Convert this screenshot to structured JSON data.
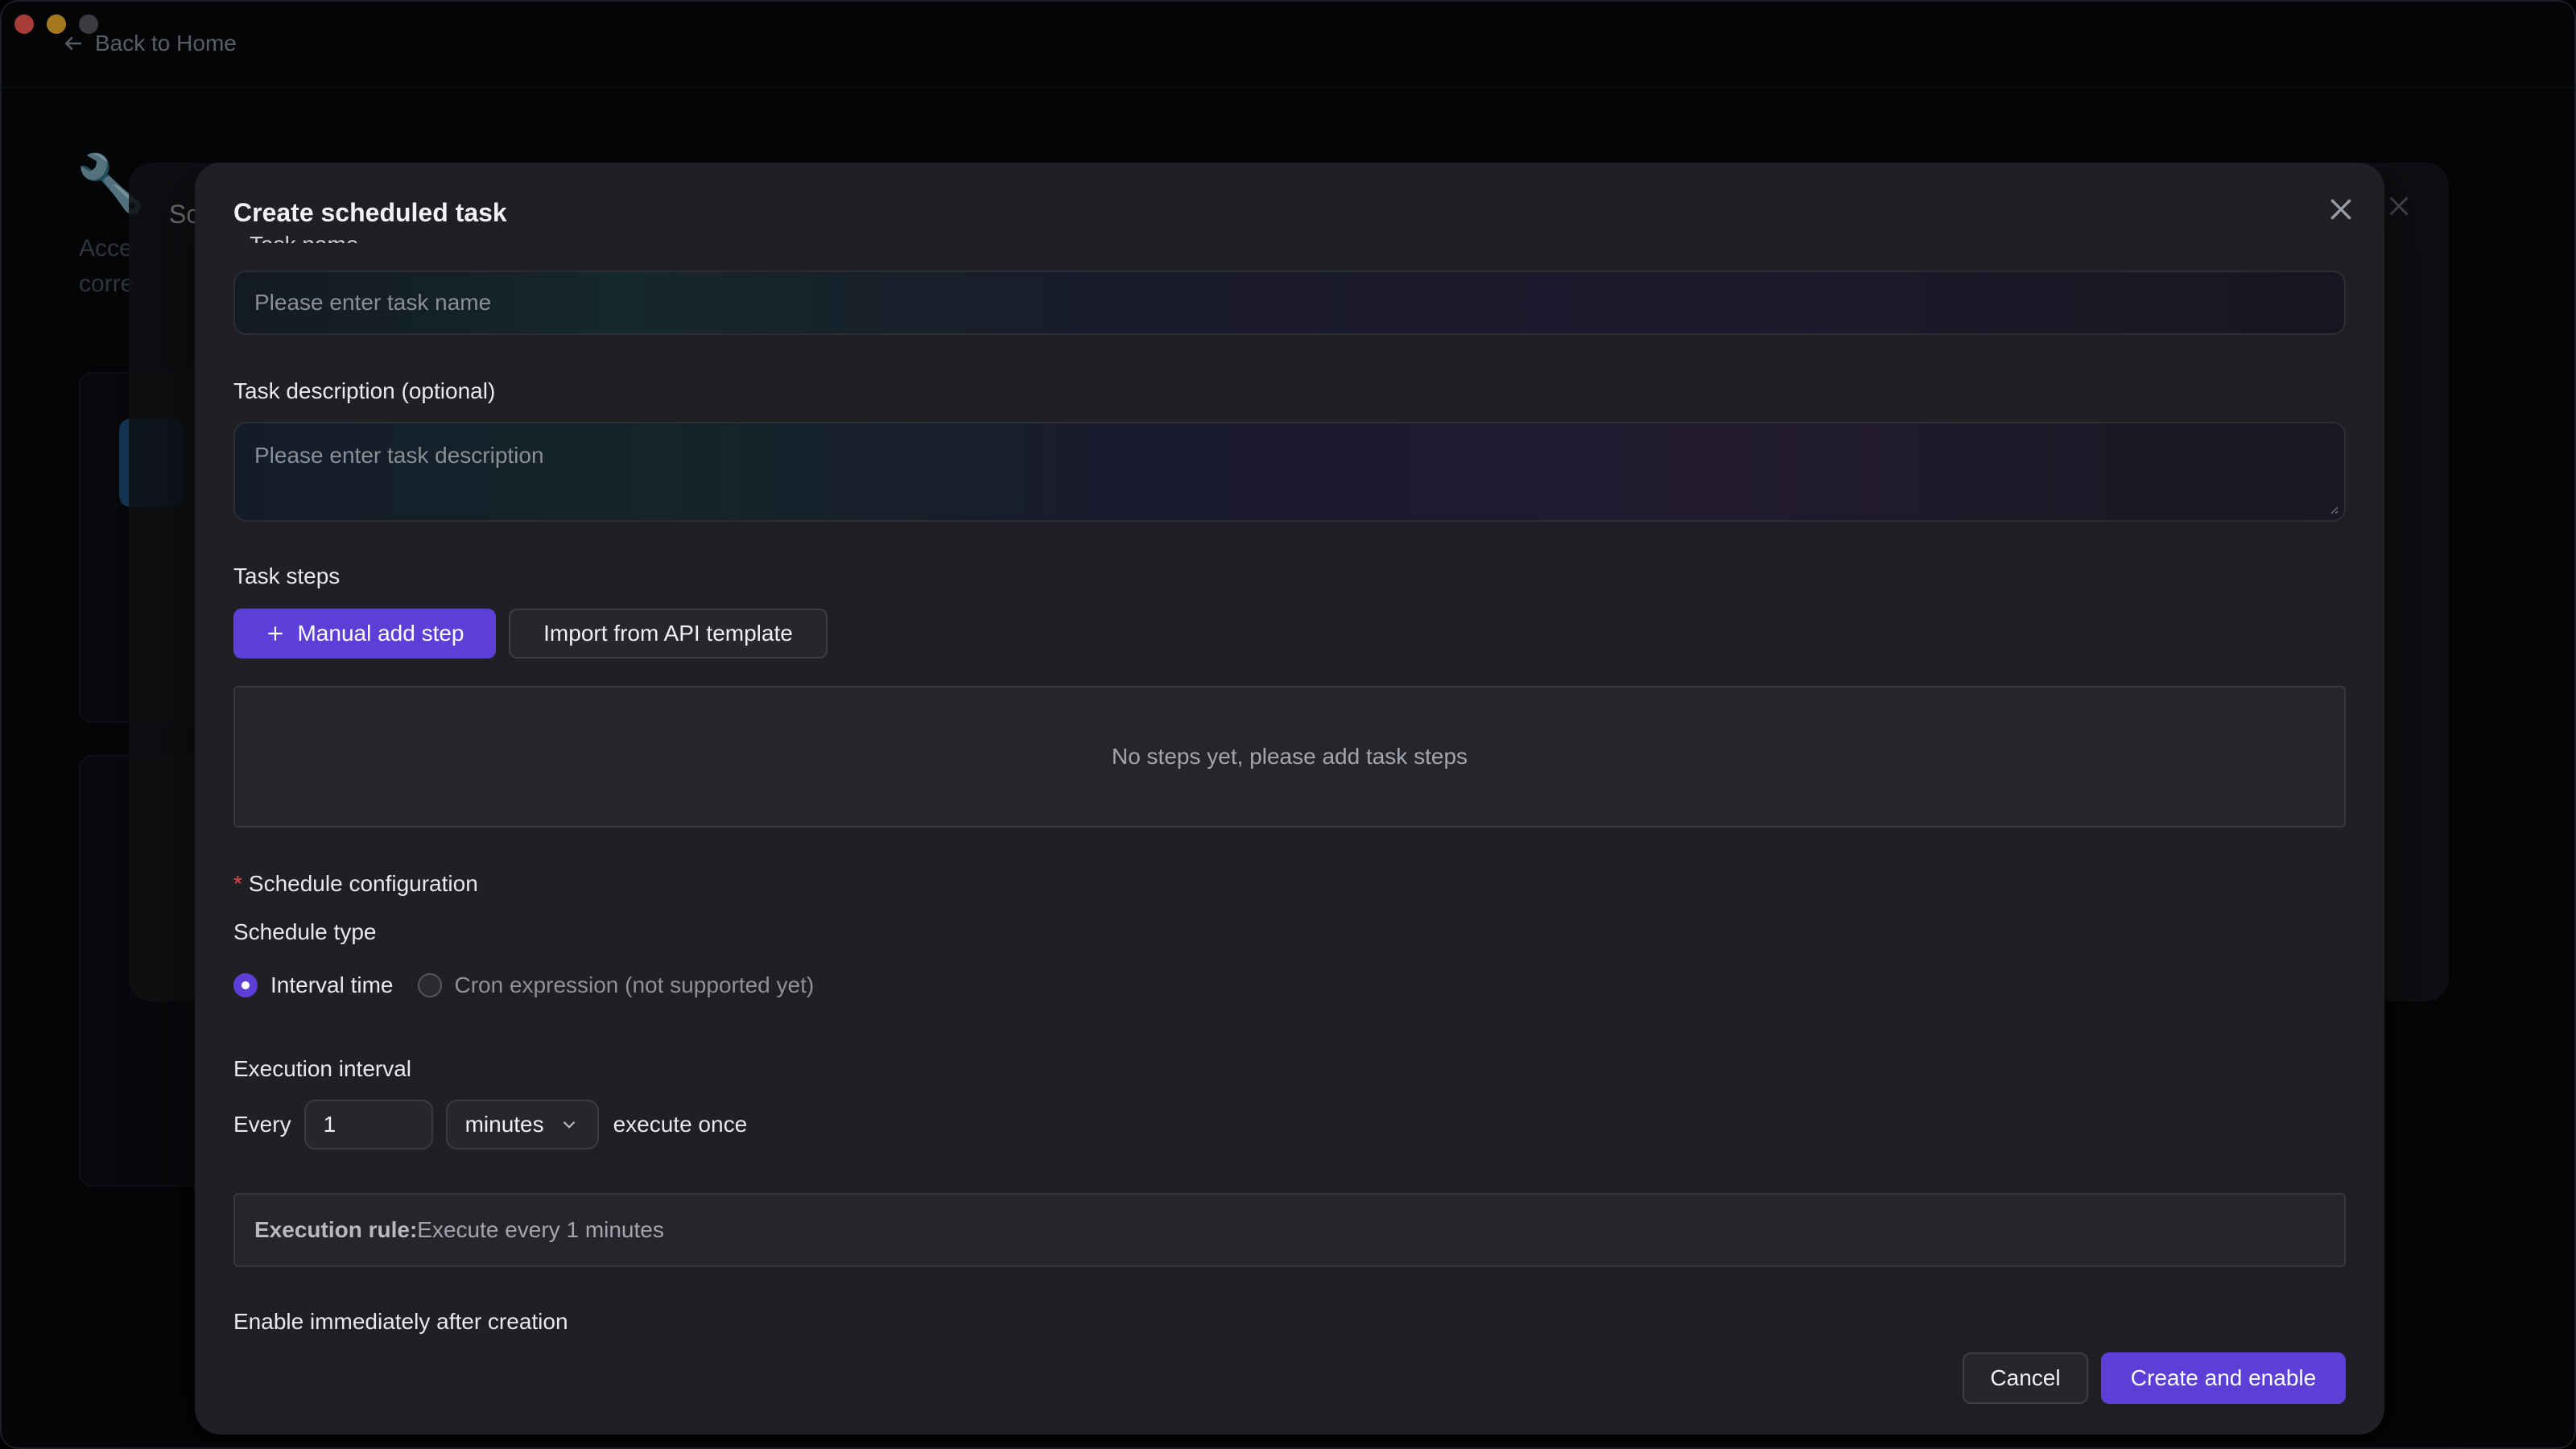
{
  "window": {
    "back_label": "Back to Home"
  },
  "background": {
    "page_title_fragment": "",
    "text_line_1": "Acce",
    "text_line_2": "corre",
    "underlay_title_fragment": "Sc"
  },
  "modal": {
    "title": "Create scheduled task",
    "task_name": {
      "label": "Task name",
      "placeholder": "Please enter task name"
    },
    "task_description": {
      "label": "Task description (optional)",
      "placeholder": "Please enter task description"
    },
    "task_steps": {
      "label": "Task steps",
      "add_button": "Manual add step",
      "import_button": "Import from API template",
      "empty_message": "No steps yet, please add task steps"
    },
    "schedule": {
      "label": "Schedule configuration",
      "required_mark": "*",
      "type_label": "Schedule type",
      "options": [
        {
          "label": "Interval time",
          "checked": true
        },
        {
          "label": "Cron expression (not supported yet)",
          "checked": false
        }
      ],
      "interval_label": "Execution interval",
      "every_label": "Every",
      "interval_value": "1",
      "unit_selected": "minutes",
      "suffix_label": "execute once",
      "rule_label": "Execution rule:",
      "rule_text": "Execute every 1 minutes"
    },
    "enable_label": "Enable immediately after creation",
    "cancel_button": "Cancel",
    "create_button": "Create and enable"
  },
  "colors": {
    "accent": "#5b3fd6",
    "required": "#e5484d",
    "modal_bg": "#1f1f24"
  }
}
